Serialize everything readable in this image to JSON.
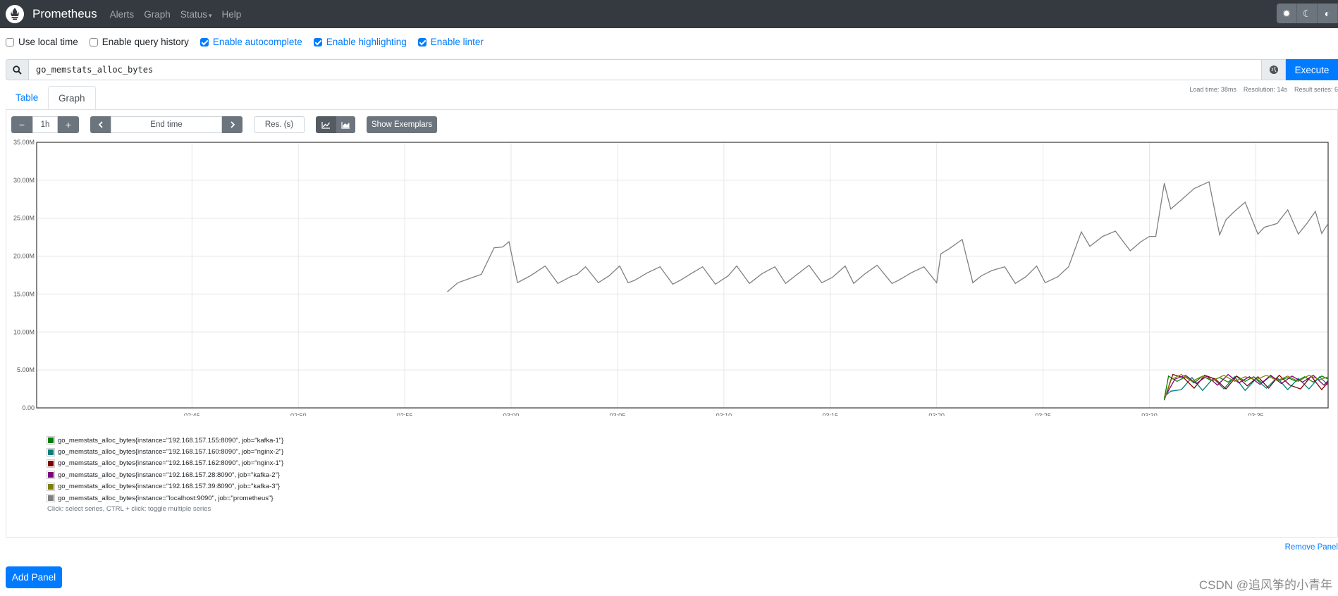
{
  "nav": {
    "brand": "Prometheus",
    "items": [
      "Alerts",
      "Graph",
      "Status",
      "Help"
    ],
    "theme_icons": [
      "sun-icon",
      "moon-icon",
      "contrast-icon"
    ]
  },
  "options": [
    {
      "label": "Use local time",
      "checked": false
    },
    {
      "label": "Enable query history",
      "checked": false
    },
    {
      "label": "Enable autocomplete",
      "checked": true
    },
    {
      "label": "Enable highlighting",
      "checked": true
    },
    {
      "label": "Enable linter",
      "checked": true
    }
  ],
  "query": {
    "expression": "go_memstats_alloc_bytes",
    "execute_label": "Execute"
  },
  "tabs": [
    {
      "label": "Table",
      "active": false
    },
    {
      "label": "Graph",
      "active": true
    }
  ],
  "stats": {
    "load_time": "Load time: 38ms",
    "resolution": "Resolution: 14s",
    "result_series": "Result series: 6"
  },
  "controls": {
    "range": "1h",
    "minus": "−",
    "plus": "+",
    "end_time_placeholder": "End time",
    "resolution_placeholder": "Res. (s)",
    "show_exemplars": "Show Exemplars"
  },
  "chart_data": {
    "type": "line",
    "ylim": [
      0,
      35000000
    ],
    "y_ticks": [
      "0.00",
      "5.00M",
      "10.00M",
      "15.00M",
      "20.00M",
      "25.00M",
      "30.00M",
      "35.00M"
    ],
    "x_ticks": [
      "02:45",
      "02:50",
      "02:55",
      "03:00",
      "03:05",
      "03:10",
      "03:15",
      "03:20",
      "03:25",
      "03:30",
      "03:35",
      "03:40"
    ],
    "x_domain_minutes": [
      -7.3,
      53.4
    ],
    "x_tick_minutes": [
      0,
      5,
      10,
      15,
      20,
      25,
      30,
      35,
      40,
      45,
      50,
      55
    ],
    "series": [
      {
        "name": "go_memstats_alloc_bytes{instance=\"192.168.157.155:8090\", job=\"kafka-1\"}",
        "color": "#008000",
        "x": [
          45.7,
          45.9,
          46.3,
          46.7,
          47.1,
          47.5,
          47.9,
          48.3,
          48.7,
          49.1,
          49.5,
          49.9,
          50.3,
          50.7,
          51.1,
          51.5,
          51.9,
          52.3,
          52.7,
          53.1,
          53.4
        ],
        "y": [
          1200000,
          4200000,
          3500000,
          4100000,
          3300000,
          4200000,
          3600000,
          4000000,
          3400000,
          4200000,
          3500000,
          4100000,
          3300000,
          4200000,
          3600000,
          4000000,
          3500000,
          4100000,
          3400000,
          4200000,
          3800000
        ]
      },
      {
        "name": "go_memstats_alloc_bytes{instance=\"192.168.157.160:8090\", job=\"nginx-2\"}",
        "color": "#008080",
        "x": [
          45.7,
          46.0,
          46.5,
          47.0,
          47.5,
          48.0,
          48.5,
          49.0,
          49.5,
          50.0,
          50.5,
          51.0,
          51.5,
          52.0,
          52.5,
          53.0,
          53.4
        ],
        "y": [
          1500000,
          2200000,
          2400000,
          4000000,
          2300000,
          3900000,
          2500000,
          4100000,
          2300000,
          3800000,
          2600000,
          4000000,
          2400000,
          3900000,
          2500000,
          4100000,
          3000000
        ]
      },
      {
        "name": "go_memstats_alloc_bytes{instance=\"192.168.157.162:8090\", job=\"nginx-1\"}",
        "color": "#800000",
        "x": [
          45.7,
          46.1,
          46.6,
          47.1,
          47.6,
          48.1,
          48.6,
          49.1,
          49.6,
          50.1,
          50.6,
          51.1,
          51.6,
          52.1,
          52.6,
          53.1,
          53.4
        ],
        "y": [
          1000000,
          4400000,
          4000000,
          2600000,
          4300000,
          3800000,
          2500000,
          4200000,
          2900000,
          4100000,
          2600000,
          4300000,
          3000000,
          2500000,
          4200000,
          2400000,
          3400000
        ]
      },
      {
        "name": "go_memstats_alloc_bytes{instance=\"192.168.157.28:8090\", job=\"kafka-2\"}",
        "color": "#800080",
        "x": [
          45.7,
          46.2,
          46.7,
          47.2,
          47.7,
          48.2,
          48.7,
          49.2,
          49.7,
          50.2,
          50.7,
          51.2,
          51.7,
          52.2,
          52.7,
          53.2,
          53.4
        ],
        "y": [
          1300000,
          3800000,
          4300000,
          3200000,
          4200000,
          3000000,
          4400000,
          3300000,
          4100000,
          3100000,
          4300000,
          3200000,
          4200000,
          3400000,
          4300000,
          3000000,
          3600000
        ]
      },
      {
        "name": "go_memstats_alloc_bytes{instance=\"192.168.157.39:8090\", job=\"kafka-3\"}",
        "color": "#808000",
        "x": [
          45.7,
          46.0,
          46.5,
          47.0,
          47.5,
          48.0,
          48.5,
          49.0,
          49.5,
          50.0,
          50.5,
          51.0,
          51.5,
          52.0,
          52.5,
          53.0,
          53.4
        ],
        "y": [
          1100000,
          3700000,
          4400000,
          3500000,
          4200000,
          3600000,
          4300000,
          3500000,
          4100000,
          3700000,
          4300000,
          3600000,
          4200000,
          3500000,
          4300000,
          3700000,
          4100000
        ]
      },
      {
        "name": "go_memstats_alloc_bytes{instance=\"localhost:9090\", job=\"prometheus\"}",
        "color": "#808080",
        "x": [
          12.0,
          12.5,
          13.0,
          13.6,
          14.2,
          14.6,
          14.9,
          15.3,
          15.5,
          15.9,
          16.6,
          17.2,
          17.8,
          18.1,
          18.5,
          19.1,
          19.6,
          20.1,
          20.5,
          20.8,
          21.4,
          22.0,
          22.6,
          23.0,
          23.4,
          24.0,
          24.6,
          25.2,
          25.6,
          26.2,
          26.8,
          27.4,
          27.9,
          28.4,
          29.0,
          29.6,
          30.1,
          30.7,
          31.1,
          31.6,
          32.2,
          32.9,
          33.2,
          33.8,
          34.4,
          35.0,
          35.2,
          35.6,
          36.2,
          36.7,
          37.1,
          37.6,
          38.2,
          38.7,
          39.2,
          39.7,
          40.1,
          40.7,
          41.2,
          41.8,
          42.2,
          42.8,
          43.4,
          44.1,
          44.6,
          45.0,
          45.3,
          45.7,
          46.0,
          46.5,
          47.1,
          47.8,
          48.3,
          48.6,
          49.0,
          49.5,
          50.1,
          50.4,
          51.0,
          51.5,
          52.0,
          52.4,
          52.8,
          53.1,
          53.4
        ],
        "y": [
          15300000,
          16500000,
          17000000,
          17600000,
          21100000,
          21200000,
          21900000,
          16500000,
          16800000,
          17400000,
          18700000,
          16400000,
          17300000,
          17600000,
          18600000,
          16500000,
          17400000,
          18700000,
          16500000,
          16800000,
          17800000,
          18600000,
          16300000,
          16900000,
          17600000,
          18600000,
          16300000,
          17400000,
          18700000,
          16400000,
          17700000,
          18600000,
          16400000,
          17500000,
          18800000,
          16500000,
          17200000,
          18700000,
          16400000,
          17600000,
          18800000,
          16400000,
          16800000,
          17800000,
          18600000,
          16500000,
          20300000,
          21000000,
          22200000,
          16500000,
          17400000,
          18100000,
          18600000,
          16400000,
          17300000,
          18700000,
          16500000,
          17300000,
          18600000,
          23200000,
          21300000,
          22600000,
          23300000,
          20700000,
          21900000,
          22600000,
          22600000,
          29600000,
          26200000,
          27400000,
          28900000,
          29800000,
          22800000,
          24800000,
          25900000,
          27100000,
          22900000,
          23800000,
          24300000,
          26100000,
          22900000,
          24300000,
          25900000,
          23000000,
          24300000
        ]
      }
    ]
  },
  "legend_hint": "Click: select series, CTRL + click: toggle multiple series",
  "remove_panel": "Remove Panel",
  "add_panel": "Add Panel",
  "watermark": "CSDN @追风筝的小青年"
}
